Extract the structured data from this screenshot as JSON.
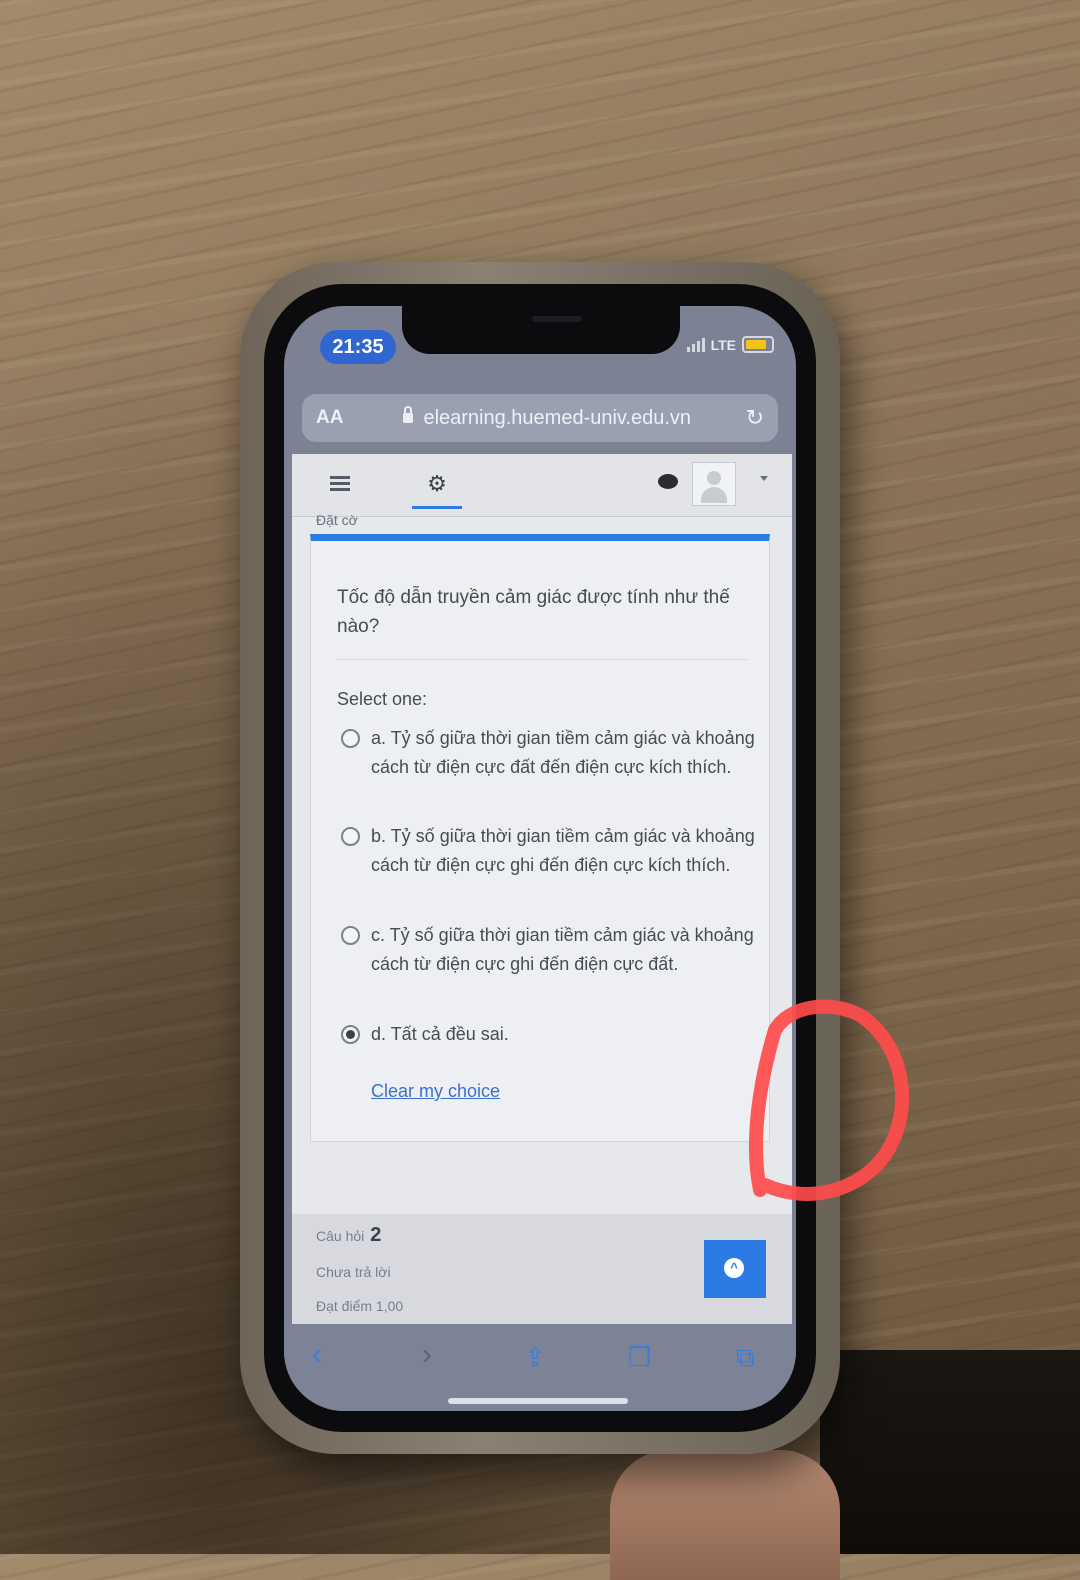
{
  "status_bar": {
    "time": "21:35",
    "network": "LTE"
  },
  "browser": {
    "text_size_label": "AA",
    "url": "elearning.huemed-univ.edu.vn",
    "reload_icon": "reload-icon"
  },
  "navbar": {
    "menu_icon": "hamburger-menu-icon",
    "settings_icon": "gears-icon",
    "message_icon": "chat-bubble-icon"
  },
  "breadcrumb": "Đặt cờ",
  "question": {
    "text": "Tốc độ dẫn truyền cảm giác được tính như thế nào?",
    "select_label": "Select one:",
    "options": [
      {
        "label": "a. Tỷ số giữa thời gian tiềm cảm giác và khoảng cách từ điện cực đất đến điện cực kích thích.",
        "selected": false
      },
      {
        "label": "b. Tỷ số giữa thời gian tiềm cảm giác và khoảng cách từ điện cực ghi đến điện cực kích thích.",
        "selected": false
      },
      {
        "label": "c. Tỷ số giữa thời gian tiềm cảm giác và khoảng cách từ điện cực ghi đến điện cực đất.",
        "selected": false
      },
      {
        "label": "d. Tất cả đều sai.",
        "selected": true
      }
    ],
    "clear_label": "Clear my choice"
  },
  "next_question_info": {
    "label": "Câu hỏi",
    "number": "2",
    "status": "Chưa trả lời",
    "mark": "Đạt điểm 1,00"
  },
  "colors": {
    "accent": "#2c7be5",
    "annotation": "#ff4b4b"
  }
}
